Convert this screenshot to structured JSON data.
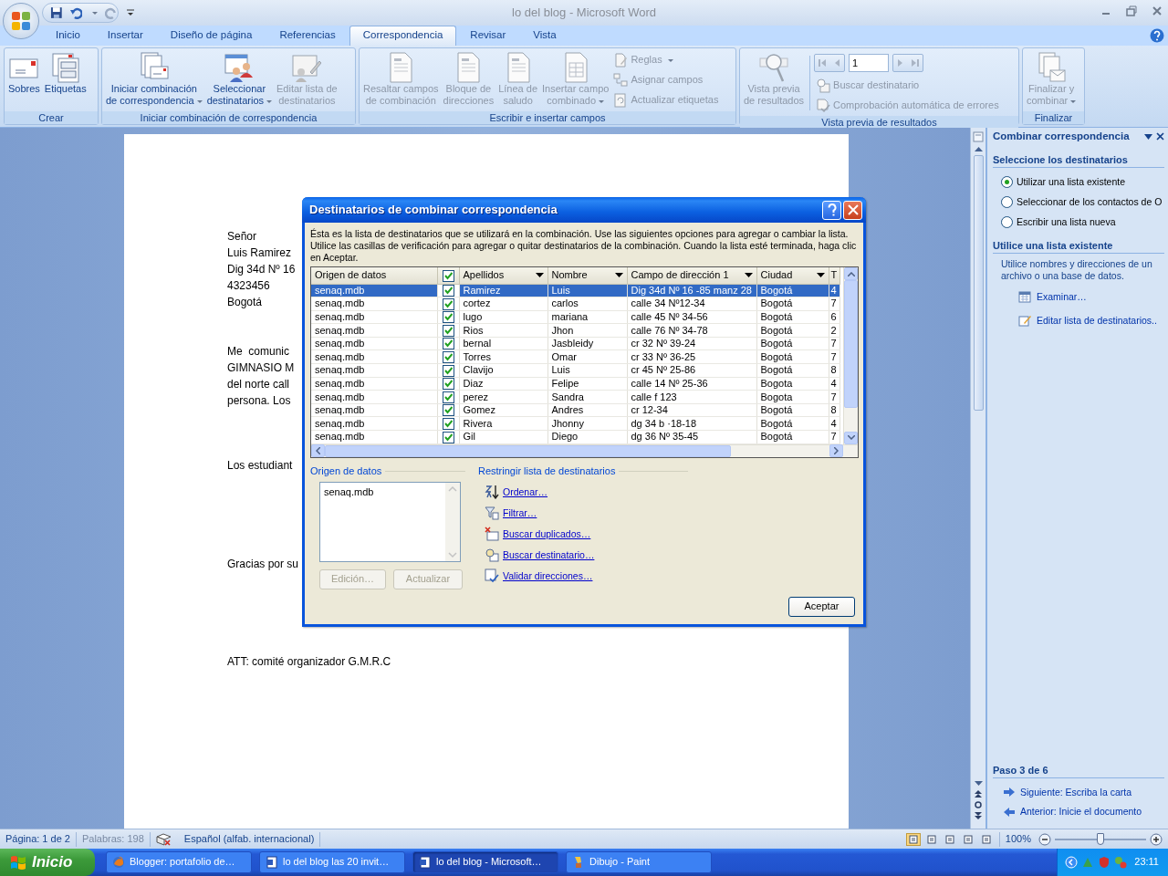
{
  "window": {
    "title": "lo del blog - Microsoft Word"
  },
  "ribbon_tabs": [
    {
      "label": "Inicio",
      "selected": false
    },
    {
      "label": "Insertar",
      "selected": false
    },
    {
      "label": "Diseño de página",
      "selected": false
    },
    {
      "label": "Referencias",
      "selected": false
    },
    {
      "label": "Correspondencia",
      "selected": true
    },
    {
      "label": "Revisar",
      "selected": false
    },
    {
      "label": "Vista",
      "selected": false
    }
  ],
  "ribbon_groups": [
    {
      "label": "Crear",
      "buttons": [
        {
          "label": "Sobres",
          "disabled": false,
          "dropdown": false
        },
        {
          "label": "Etiquetas",
          "disabled": false,
          "dropdown": false
        }
      ]
    },
    {
      "label": "Iniciar combinación de correspondencia",
      "buttons": [
        {
          "label": "Iniciar combinación\nde correspondencia",
          "disabled": false,
          "dropdown": true
        },
        {
          "label": "Seleccionar\ndestinatarios",
          "disabled": false,
          "dropdown": true
        },
        {
          "label": "Editar lista de\ndestinatarios",
          "disabled": true,
          "dropdown": false
        }
      ]
    },
    {
      "label": "Escribir e insertar campos",
      "buttons": [
        {
          "label": "Resaltar campos\nde combinación",
          "disabled": true,
          "dropdown": false
        },
        {
          "label": "Bloque de\ndirecciones",
          "disabled": true,
          "dropdown": false
        },
        {
          "label": "Línea de\nsaludo",
          "disabled": true,
          "dropdown": false
        },
        {
          "label": "Insertar campo\ncombinado",
          "disabled": true,
          "dropdown": true
        }
      ],
      "small_buttons": [
        {
          "label": "Reglas",
          "disabled": true,
          "dropdown": true
        },
        {
          "label": "Asignar campos",
          "disabled": true,
          "dropdown": false
        },
        {
          "label": "Actualizar etiquetas",
          "disabled": true,
          "dropdown": false
        }
      ]
    },
    {
      "label": "Vista previa de resultados",
      "buttons": [
        {
          "label": "Vista previa\nde resultados",
          "disabled": true,
          "dropdown": false
        }
      ],
      "navigator": {
        "record": "1",
        "disabled": true
      },
      "small_buttons": [
        {
          "label": "Buscar destinatario",
          "disabled": true,
          "dropdown": false
        },
        {
          "label": "Comprobación automática de errores",
          "disabled": true,
          "dropdown": false
        }
      ]
    },
    {
      "label": "Finalizar",
      "buttons": [
        {
          "label": "Finalizar y\ncombinar",
          "disabled": true,
          "dropdown": true
        }
      ]
    }
  ],
  "document": {
    "paragraphs": [
      [
        "Señor",
        "Luis Ramirez",
        "Dig 34d Nº 16",
        "4323456",
        "Bogotá"
      ],
      [
        "Me  comunic",
        "GIMNASIO M",
        "del norte call",
        "persona. Los"
      ],
      [
        "Los estudiant"
      ],
      [
        "Gracias por su"
      ],
      [
        "ATT: comité organizador G.M.R.C"
      ]
    ]
  },
  "dialog": {
    "title": "Destinatarios de combinar correspondencia",
    "description": "Ésta es la lista de destinatarios que se utilizará en la combinación. Use las siguientes opciones para agregar o cambiar la lista. Utilice las casillas de verificación para agregar o quitar destinatarios de la combinación. Cuando la lista esté terminada, haga clic en Aceptar.",
    "header_checked": true,
    "columns": [
      {
        "label": "Origen de datos",
        "dropdown": false
      },
      {
        "label": "Apellidos",
        "dropdown": true
      },
      {
        "label": "Nombre",
        "dropdown": true
      },
      {
        "label": "Campo de dirección 1",
        "dropdown": true
      },
      {
        "label": "Ciudad",
        "dropdown": true
      },
      {
        "label": "T",
        "dropdown": false
      }
    ],
    "rows": [
      {
        "checked": true,
        "selected": true,
        "cells": [
          "senaq.mdb",
          "Ramirez",
          "Luis",
          "Dig 34d Nº 16 -85 manz 28",
          "Bogotá",
          "4"
        ]
      },
      {
        "checked": true,
        "selected": false,
        "cells": [
          "senaq.mdb",
          "cortez",
          "carlos",
          "calle 34 Nº12-34",
          "Bogotá",
          "7"
        ]
      },
      {
        "checked": true,
        "selected": false,
        "cells": [
          "senaq.mdb",
          "lugo",
          "mariana",
          "calle 45 Nº 34-56",
          "Bogotá",
          "6"
        ]
      },
      {
        "checked": true,
        "selected": false,
        "cells": [
          "senaq.mdb",
          "Rios",
          "Jhon",
          "calle 76 Nº 34-78",
          "Bogotá",
          "2"
        ]
      },
      {
        "checked": true,
        "selected": false,
        "cells": [
          "senaq.mdb",
          "bernal",
          "Jasbleidy",
          "cr 32 Nº 39-24",
          "Bogotá",
          "7"
        ]
      },
      {
        "checked": true,
        "selected": false,
        "cells": [
          "senaq.mdb",
          "Torres",
          "Omar",
          "cr 33 Nº 36-25",
          "Bogotá",
          "7"
        ]
      },
      {
        "checked": true,
        "selected": false,
        "cells": [
          "senaq.mdb",
          "Clavijo",
          "Luis",
          "cr 45 Nº 25-86",
          "Bogotá",
          "8"
        ]
      },
      {
        "checked": true,
        "selected": false,
        "cells": [
          "senaq.mdb",
          "Diaz",
          "Felipe",
          "calle 14 Nº 25-36",
          "Bogota",
          "4"
        ]
      },
      {
        "checked": true,
        "selected": false,
        "cells": [
          "senaq.mdb",
          "perez",
          "Sandra",
          "calle f 123",
          "Bogota",
          "7"
        ]
      },
      {
        "checked": true,
        "selected": false,
        "cells": [
          "senaq.mdb",
          "Gomez",
          "Andres",
          "cr 12-34",
          "Bogotá",
          "8"
        ]
      },
      {
        "checked": true,
        "selected": false,
        "cells": [
          "senaq.mdb",
          "Rivera",
          "Jhonny",
          "dg 34 b ·18-18",
          "Bogotá",
          "4"
        ]
      },
      {
        "checked": true,
        "selected": false,
        "cells": [
          "senaq.mdb",
          "Gil",
          "Diego",
          "dg 36 Nº 35-45",
          "Bogotá",
          "7"
        ]
      }
    ],
    "source_label": "Origen de datos",
    "sources": [
      "senaq.mdb"
    ],
    "source_buttons": [
      {
        "label": "Edición…",
        "disabled": true
      },
      {
        "label": "Actualizar",
        "disabled": true
      }
    ],
    "refine_label": "Restringir lista de destinatarios",
    "refine_links": [
      "Ordenar…",
      "Filtrar…",
      "Buscar duplicados…",
      "Buscar destinatario…",
      "Validar direcciones…"
    ],
    "ok_button": "Aceptar"
  },
  "task_pane": {
    "title": "Combinar correspondencia",
    "select_heading": "Seleccione los destinatarios",
    "options": [
      {
        "label": "Utilizar una lista existente",
        "selected": true
      },
      {
        "label": "Seleccionar de los contactos de O",
        "selected": false
      },
      {
        "label": "Escribir una lista nueva",
        "selected": false
      }
    ],
    "existing_heading": "Utilice una lista existente",
    "existing_text": "Utilice nombres y direcciones de un archivo o una base de datos.",
    "links": [
      "Examinar…",
      "Editar lista de destinatarios.."
    ],
    "step": "Paso 3 de 6",
    "next": "Siguiente: Escriba la carta",
    "previous": "Anterior: Inicie el documento"
  },
  "status_bar": {
    "page": "Página: 1 de 2",
    "words": "Palabras: 198",
    "language": "Español (alfab. internacional)",
    "views": [
      {
        "selected": true
      },
      {
        "selected": false
      },
      {
        "selected": false
      },
      {
        "selected": false
      },
      {
        "selected": false
      }
    ],
    "zoom": "100%",
    "zoom_slider": {
      "level": 0.5
    }
  },
  "taskbar": {
    "start": "Inicio",
    "tasks": [
      {
        "label": "Blogger: portafolio de…",
        "selected": false
      },
      {
        "label": "lo del blog las 20 invit…",
        "selected": false
      },
      {
        "label": "lo del blog - Microsoft…",
        "selected": true
      },
      {
        "label": "Dibujo - Paint",
        "selected": false
      }
    ],
    "clock": "23:11"
  }
}
